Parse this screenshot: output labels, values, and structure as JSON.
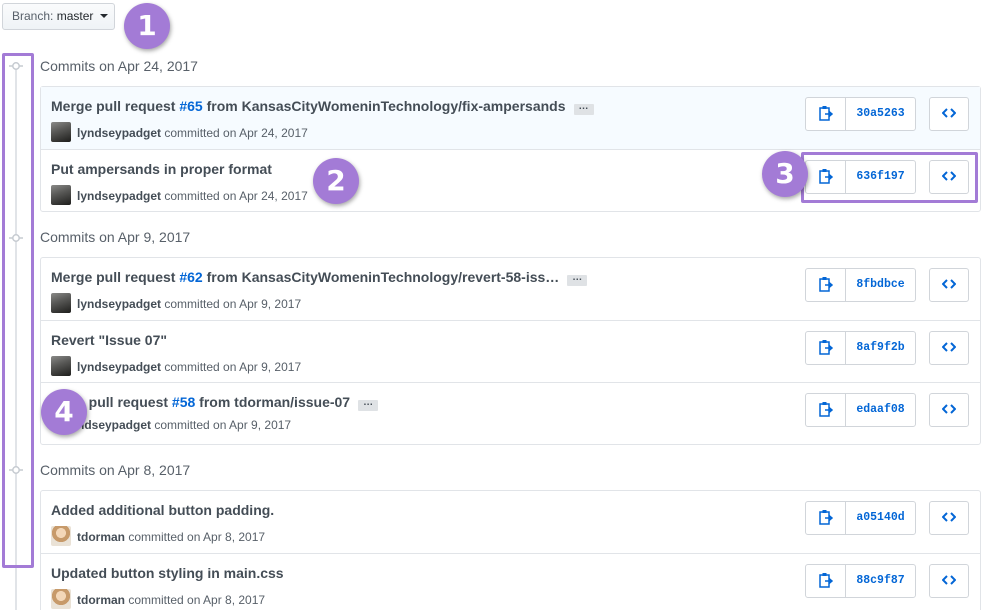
{
  "branch": {
    "label": "Branch:",
    "value": "master"
  },
  "groups": [
    {
      "title": "Commits on Apr 24, 2017",
      "commits": [
        {
          "title_pre": "Merge pull request ",
          "pr": "#65",
          "title_post": " from KansasCityWomeninTechnology/fix-ampersands",
          "ellipsis": "…",
          "author": "lyndseypadget",
          "meta": " committed on Apr 24, 2017",
          "sha": "30a5263"
        },
        {
          "title_pre": "Put ampersands in proper format",
          "author": "lyndseypadget",
          "meta": " committed on Apr 24, 2017",
          "sha": "636f197"
        }
      ]
    },
    {
      "title": "Commits on Apr 9, 2017",
      "commits": [
        {
          "title_pre": "Merge pull request ",
          "pr": "#62",
          "title_post": " from KansasCityWomeninTechnology/revert-58-iss…",
          "ellipsis": "…",
          "author": "lyndseypadget",
          "meta": " committed on Apr 9, 2017",
          "sha": "8fbdbce"
        },
        {
          "title_pre": "Revert \"Issue 07\"",
          "author": "lyndseypadget",
          "meta": " committed on Apr 9, 2017",
          "sha": "8af9f2b"
        },
        {
          "title_pre": "e pull request ",
          "pr": "#58",
          "title_post": " from tdorman/issue-07",
          "ellipsis": "…",
          "author": "ndseypadget",
          "meta": " committed on Apr 9, 2017",
          "sha": "edaaf08"
        }
      ]
    },
    {
      "title": "Commits on Apr 8, 2017",
      "commits": [
        {
          "title_pre": "Added additional button padding.",
          "author": "tdorman",
          "meta": " committed on Apr 8, 2017",
          "sha": "a05140d"
        },
        {
          "title_pre": "Updated button styling in main.css",
          "author": "tdorman",
          "meta": " committed on Apr 8, 2017",
          "sha": "88c9f87"
        }
      ]
    }
  ],
  "badges": [
    "1",
    "2",
    "3",
    "4"
  ],
  "colors": {
    "accent": "#a37bd6",
    "link": "#0366d6"
  },
  "icons": {
    "copy": "clipboard-icon",
    "browse": "code-icon",
    "timeline": "commit-node-icon"
  }
}
